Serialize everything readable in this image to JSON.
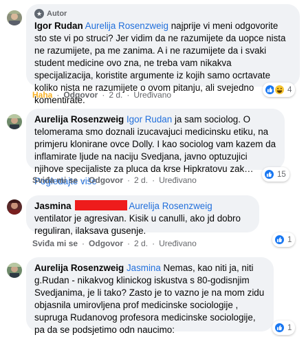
{
  "colors": {
    "mention": "#216fdb",
    "bubble": "#f0f2f5",
    "like": "#1877f2",
    "haha": "#f7b125",
    "redaction": "#ee1c1c"
  },
  "comments": [
    {
      "author_tag": "Autor",
      "author": "Igor Rudan",
      "mention": "Aurelija Rosenzweig",
      "body": " najprije vi meni odgovorite sto ste vi po struci? Jer vidim da ne razumijete da uopce nista ne razumijete, pa me zanima. A i ne razumijete da i svaki student medicine ovo zna, ne treba vam nikakva specijalizacija, koristite argumente iz kojih samo ocrtavate koliko nista ne razumijete o ovom pitanju, ali svejedno komentirate.",
      "action_primary": "Haha",
      "action_reply": "Odgovor",
      "time": "2 d.",
      "edited": "Uređivano",
      "reaction_icons": [
        "like-icon",
        "haha-icon"
      ],
      "reaction_count": "4"
    },
    {
      "author": "Aurelija Rosenzweig",
      "mention": "Igor Rudan",
      "body": " ja sam sociolog. O telomerama smo doznali izucavajuci medicinsku etiku, na primjeru klonirane ovce Dolly. I kao sociolog vam kazem da inflamirate ljude na naciju Svedjana, javno optuzujici njihove specijaliste za pluca da krse Hipkratovu zak…",
      "see_more": "Pogledajte više",
      "action_primary": "Sviđa mi se",
      "action_reply": "Odgovor",
      "time": "2 d.",
      "edited": "Uređivano",
      "reaction_icons": [
        "like-icon"
      ],
      "reaction_count": "15"
    },
    {
      "author": "Jasmina",
      "mention": "Aurelija Rosenzweig",
      "body": " ventilator je agresivan. Kisik u canulli, ako jd dobro reguliran, ilaksava gusenje.",
      "action_primary": "Sviđa mi se",
      "action_reply": "Odgovor",
      "time": "2 d.",
      "edited": "Uređivano",
      "reaction_icons": [
        "like-icon"
      ],
      "reaction_count": "1"
    },
    {
      "author": "Aurelija Rosenzweig",
      "mention": "Jasmina",
      "body": " Nemas, kao niti ja, niti g.Rudan - nikakvog klinickog iskustva s 80-godisnjim Svedjanima, je li tako? Zasto je to vazno je na mom zidu objasnila umirovljena prof medicinske sociologije , supruga Rudanovog profesora medicinske sociologije, pa da se podsjetimo odn naucimo:",
      "action_primary": "Sviđa mi se",
      "action_reply": "Odgovor",
      "time": "2 d.",
      "edited": "Uređivano",
      "reaction_icons": [
        "like-icon"
      ],
      "reaction_count": "1"
    }
  ]
}
